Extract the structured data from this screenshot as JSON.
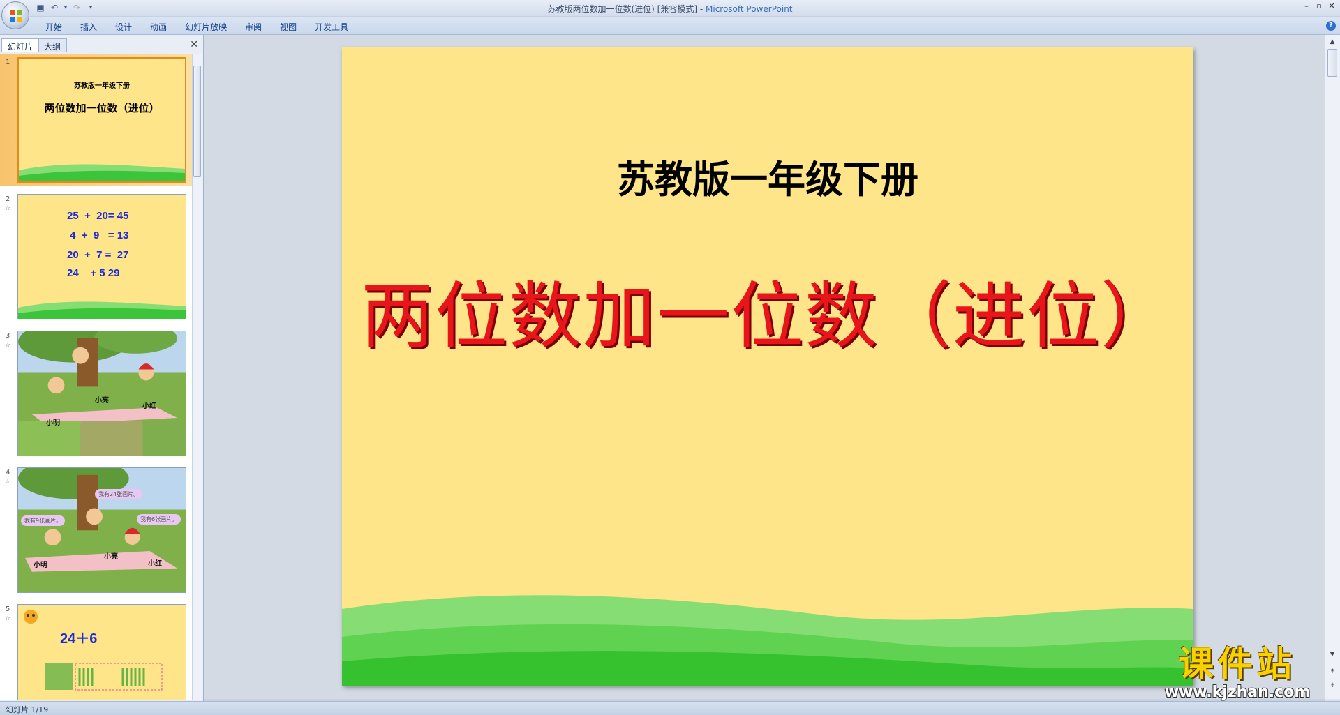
{
  "window": {
    "title": "苏教版两位数加一位数(进位) [兼容模式] - ",
    "app_name": "Microsoft PowerPoint"
  },
  "ribbon": {
    "tabs": [
      "开始",
      "插入",
      "设计",
      "动画",
      "幻灯片放映",
      "审阅",
      "视图",
      "开发工具"
    ]
  },
  "left_pane": {
    "tabs": [
      "幻灯片",
      "大纲"
    ]
  },
  "thumbnails": [
    {
      "number": "1",
      "subtitle": "苏教版一年级下册",
      "title": "两位数加一位数（进位）"
    },
    {
      "number": "2",
      "lines": [
        "25  +  20= 45",
        " 4  +  9   = 13",
        "20  +  7 =  27",
        "24    + 5 29"
      ]
    },
    {
      "number": "3",
      "labels": [
        "小亮",
        "小红",
        "小明"
      ]
    },
    {
      "number": "4",
      "labels": [
        "小明",
        "小亮",
        "小红"
      ],
      "bubbles": [
        "我有24张画片。",
        "我有9张画片。",
        "我有6张画片。"
      ]
    },
    {
      "number": "5",
      "equation": "24＋6"
    }
  ],
  "slide": {
    "subtitle": "苏教版一年级下册",
    "title": "两位数加一位数（进位）"
  },
  "watermark": {
    "text": "课件站",
    "url": "www.kjzhan.com"
  },
  "status": {
    "slide_indicator": "幻灯片 1/19"
  },
  "colors": {
    "slide_background": "#fee589",
    "title_red": "#e8161a",
    "equation_blue": "#1c2bd6",
    "selection_orange": "#e38a1f"
  }
}
